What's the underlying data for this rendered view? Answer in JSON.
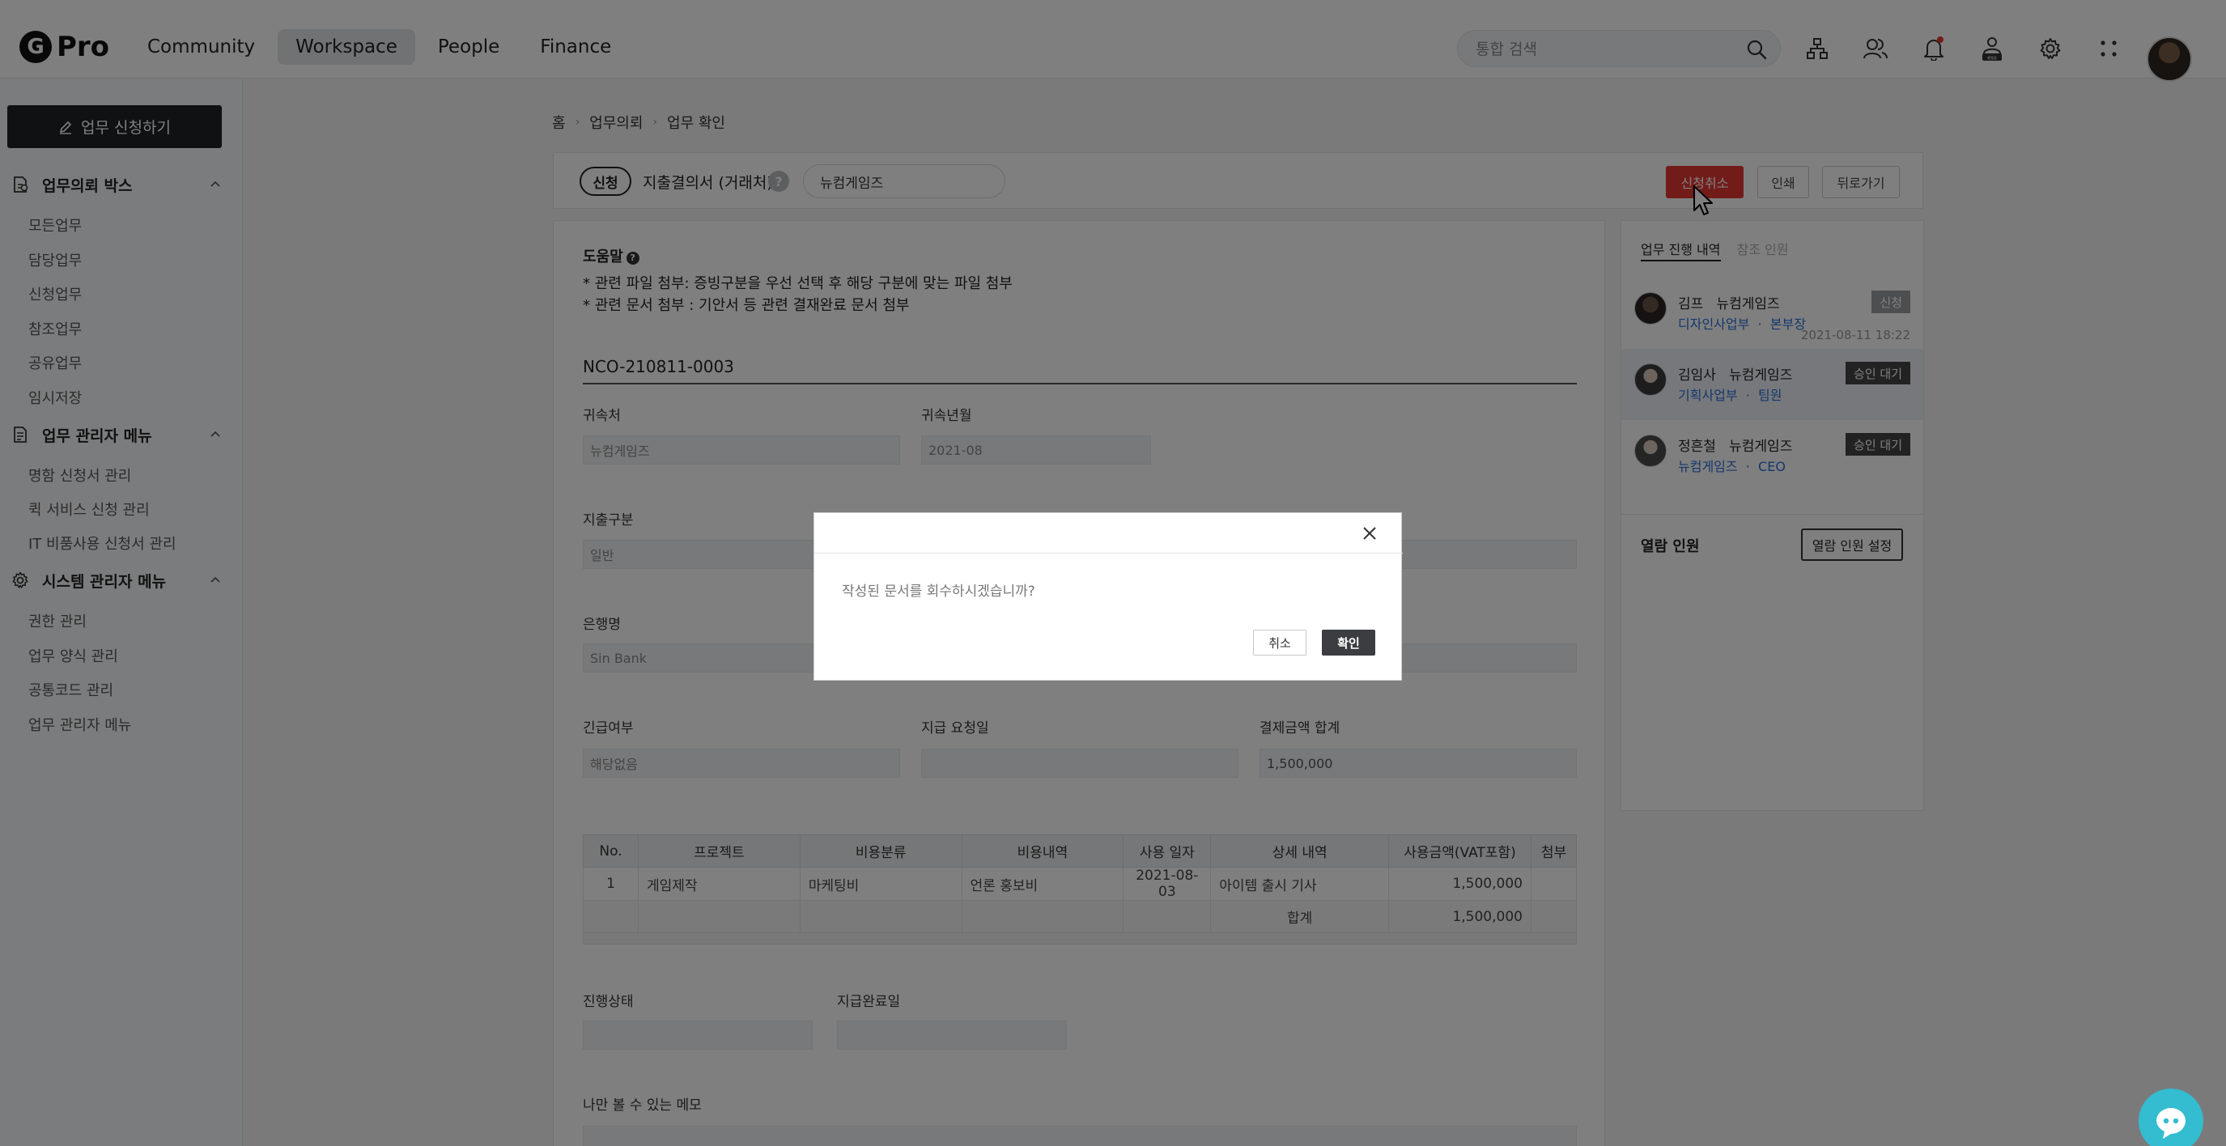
{
  "header": {
    "logo_letter": "G",
    "logo_text": "Pro",
    "nav": [
      "Community",
      "Workspace",
      "People",
      "Finance"
    ],
    "active_nav": "Workspace",
    "search_placeholder": "통합 검색",
    "icons": [
      "org-chart-icon",
      "people-icon",
      "bell-icon",
      "ess-icon",
      "gear-icon",
      "apps-grid-icon"
    ]
  },
  "sidebar": {
    "apply_button": "업무 신청하기",
    "sections": [
      {
        "title": "업무의뢰 박스",
        "icon": "document-box-icon",
        "items": [
          "모든업무",
          "담당업무",
          "신청업무",
          "참조업무",
          "공유업무",
          "임시저장"
        ]
      },
      {
        "title": "업무 관리자 메뉴",
        "icon": "document-list-icon",
        "items": [
          "명함 신청서 관리",
          "퀵 서비스 신청 관리",
          "IT 비품사용 신청서 관리"
        ]
      },
      {
        "title": "시스템 관리자 메뉴",
        "icon": "settings-icon",
        "items": [
          "권한 관리",
          "업무 양식 관리",
          "공통코드 관리",
          "업무 관리자 메뉴"
        ]
      }
    ]
  },
  "breadcrumb": [
    "홈",
    "업무의뢰",
    "업무 확인"
  ],
  "doc_bar": {
    "status_tag": "신청",
    "title": "지출결의서 (거래처)",
    "company": "뉴컴게임즈",
    "buttons": {
      "cancel_request": "신청취소",
      "print": "인쇄",
      "back": "뒤로가기"
    }
  },
  "form": {
    "help_title": "도움말",
    "help_lines": [
      "* 관련 파일 첨부: 증빙구분을 우선 선택 후 해당 구분에 맞는 파일 첨부",
      "* 관련 문서 첨부 : 기안서 등 관련 결재완료 문서 첨부"
    ],
    "doc_no": "NCO-210811-0003",
    "fields": {
      "affiliation": {
        "label": "귀속처",
        "value": "뉴컴게임즈"
      },
      "period": {
        "label": "귀속년월",
        "value": "2021-08"
      },
      "expense_type": {
        "label": "지출구분",
        "value": "일반"
      },
      "bank": {
        "label": "은행명",
        "value": "Sin Bank"
      },
      "urgent": {
        "label": "긴급여부",
        "value": "해당없음"
      },
      "pay_request_date": {
        "label": "지급 요청일",
        "value": ""
      },
      "total_amount": {
        "label": "결제금액 합계",
        "value": "1,500,000"
      },
      "progress": {
        "label": "진행상태",
        "value": ""
      },
      "paid_date": {
        "label": "지급완료일",
        "value": ""
      },
      "memo": {
        "label": "나만 볼 수 있는 메모"
      }
    },
    "table": {
      "headers": [
        "No.",
        "프로젝트",
        "비용분류",
        "비용내역",
        "사용 일자",
        "상세 내역",
        "사용금액(VAT포함)",
        "첨부"
      ],
      "rows": [
        [
          "1",
          "게임제작",
          "마케팅비",
          "언론 홍보비",
          "2021-08-03",
          "아이템 출시 기사",
          "1,500,000",
          ""
        ]
      ],
      "sum_label": "합계",
      "sum_value": "1,500,000"
    }
  },
  "side_panel": {
    "tabs": [
      "업무 진행 내역",
      "참조 인원"
    ],
    "approvers": [
      {
        "name": "김프",
        "company": "뉴컴게임즈",
        "dept": "디자인사업부",
        "role": "본부장",
        "badge": "신청",
        "time": "2021-08-11 18:22"
      },
      {
        "name": "김임사",
        "company": "뉴컴게임즈",
        "dept": "기획사업부",
        "role": "팀원",
        "badge": "승인 대기",
        "time": ""
      },
      {
        "name": "정흔철",
        "company": "뉴컴게임즈",
        "dept": "뉴컴게임즈",
        "role": "CEO",
        "badge": "승인 대기",
        "time": ""
      }
    ],
    "readers_title": "열람 인원",
    "readers_button": "열람 인원 설정"
  },
  "modal": {
    "message": "작성된 문서를 회수하시겠습니까?",
    "cancel": "취소",
    "confirm": "확인"
  },
  "colors": {
    "accent_red": "#e53935",
    "link_blue": "#2a6fd8",
    "chat_teal": "#34bcd0"
  }
}
